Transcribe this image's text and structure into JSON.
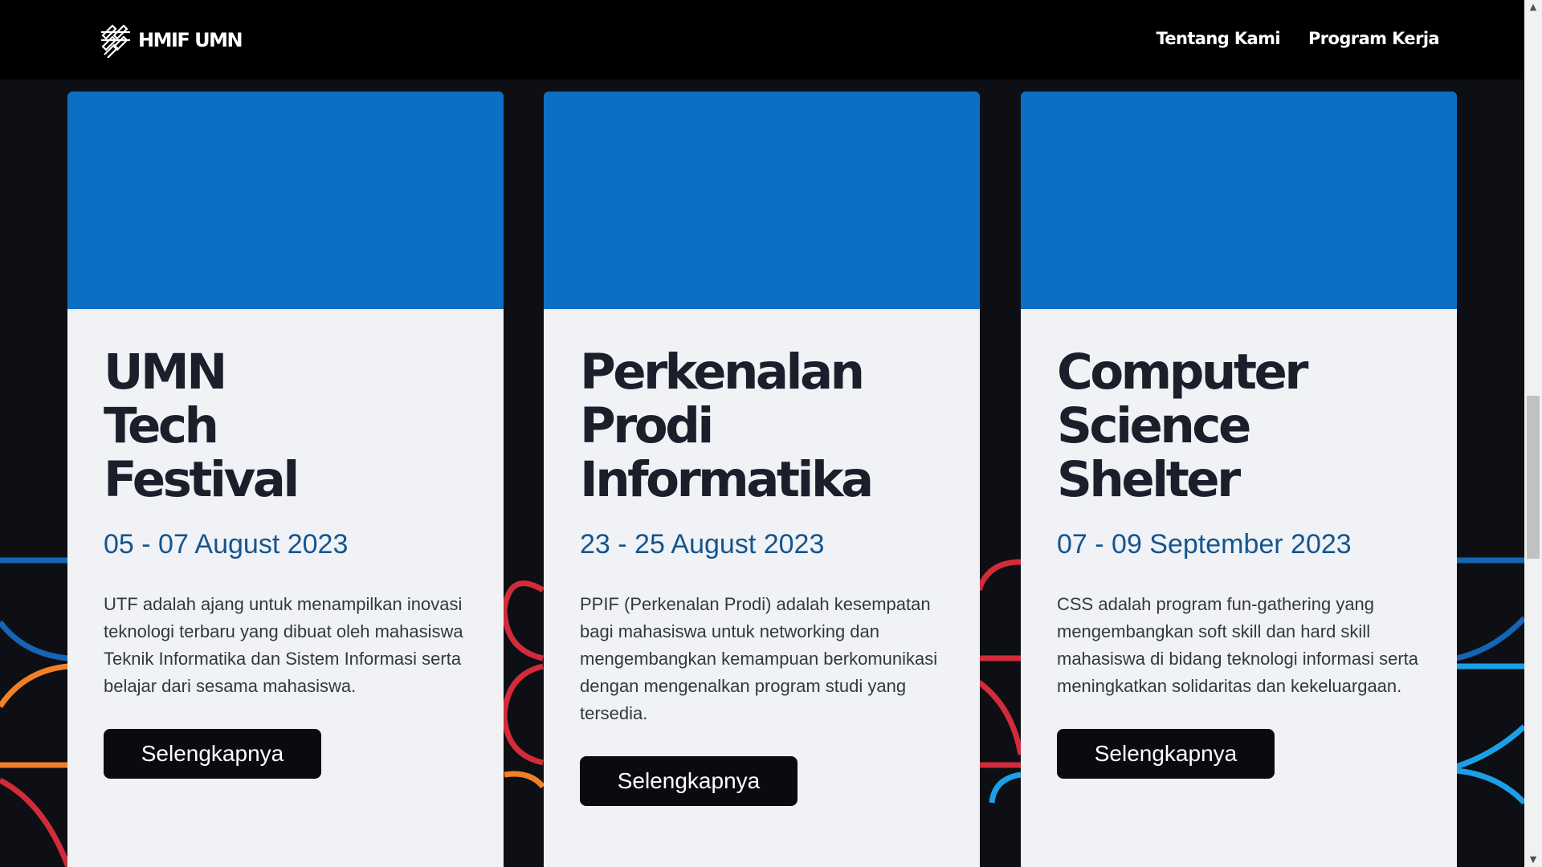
{
  "nav": {
    "logo_text": "HMIF UMN",
    "links": [
      "Tentang Kami",
      "Program Kerja"
    ]
  },
  "cards": [
    {
      "title": "UMN Tech Festival",
      "date": "05 - 07 August 2023",
      "description": "UTF adalah ajang untuk menampilkan inovasi teknologi terbaru yang dibuat oleh mahasiswa Teknik Informatika dan Sistem Informasi serta belajar dari sesama mahasiswa.",
      "button": "Selengkapnya"
    },
    {
      "title": "Perkenalan Prodi Informatika",
      "date": "23 - 25 August 2023",
      "description": "PPIF (Perkenalan Prodi) adalah kesempatan bagi mahasiswa untuk networking dan mengembangkan kemampuan berkomunikasi dengan mengenalkan program studi yang tersedia.",
      "button": "Selengkapnya"
    },
    {
      "title": "Computer Science Shelter",
      "date": "07 - 09 September 2023",
      "description": "CSS adalah program fun-gathering yang mengembangkan soft skill dan hard skill mahasiswa di bidang teknologi informasi serta meningkatkan solidaritas dan kekeluargaan.",
      "button": "Selengkapnya"
    }
  ],
  "colors": {
    "card_image": "#0b6fc4",
    "date_text": "#14558f",
    "deco_blue": "#1565b5",
    "deco_orange": "#f07f2a",
    "deco_red": "#d22b3a",
    "deco_sky": "#1aa0e6"
  },
  "icons": {
    "logo": "hmif-logo-icon",
    "scroll_up": "scroll-up-arrow-icon",
    "scroll_down": "scroll-down-arrow-icon"
  }
}
